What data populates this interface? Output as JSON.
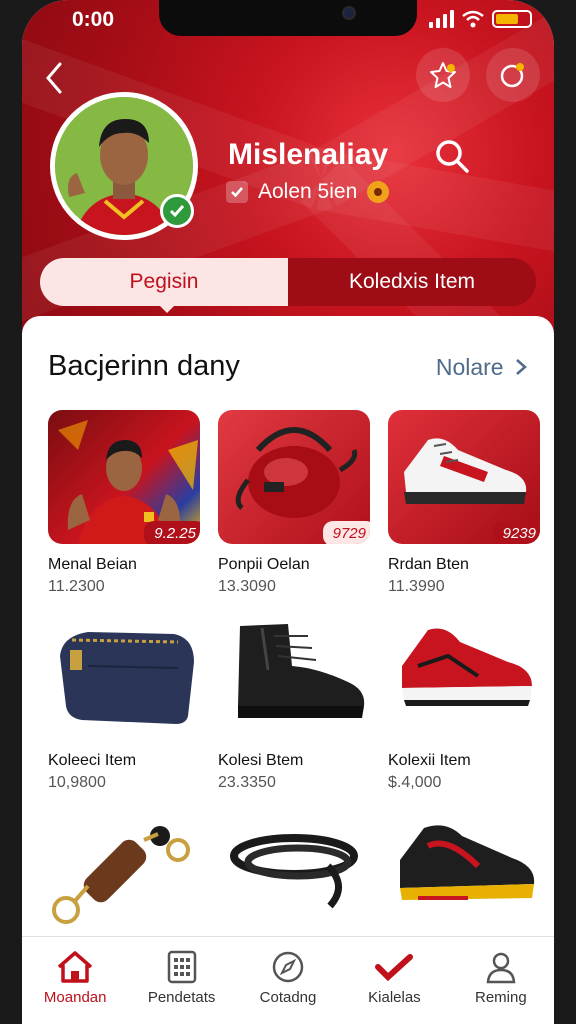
{
  "status_bar": {
    "time": "0:00"
  },
  "profile": {
    "name": "Mislenaliay",
    "subtitle": "Aolen 5ien"
  },
  "tabs": [
    {
      "label": "Pegisin",
      "active": true
    },
    {
      "label": "Koledxis Item",
      "active": false
    }
  ],
  "section": {
    "title": "Bacjerinn dany",
    "more_label": "Nolare"
  },
  "items": [
    {
      "name": "Menal Beian",
      "price": "11.2300",
      "badge": "9.2.25",
      "image": "player-poster"
    },
    {
      "name": "Ponpii Oelan",
      "price": "13.3090",
      "badge": "9729",
      "image": "red-helmet-bag"
    },
    {
      "name": "Rrdan Bten",
      "price": "11.3990",
      "badge": "9239",
      "image": "white-red-sneaker"
    },
    {
      "name": "Koleeci Item",
      "price": "10,9800",
      "badge": "",
      "image": "navy-pouch"
    },
    {
      "name": "Kolesi Btem",
      "price": "23.3350",
      "badge": "",
      "image": "black-boot"
    },
    {
      "name": "Kolexii Item",
      "price": "$.4,000",
      "badge": "",
      "image": "red-sneaker"
    },
    {
      "name": "",
      "price": "",
      "badge": "",
      "image": "keychain"
    },
    {
      "name": "",
      "price": "",
      "badge": "",
      "image": "black-laces"
    },
    {
      "name": "",
      "price": "",
      "badge": "",
      "image": "black-yellow-boot"
    }
  ],
  "bottom_nav": [
    {
      "label": "Moandan",
      "icon": "home-icon",
      "active": true
    },
    {
      "label": "Pendetats",
      "icon": "calendar-grid-icon",
      "active": false
    },
    {
      "label": "Cotadng",
      "icon": "compass-icon",
      "active": false
    },
    {
      "label": "Kialelas",
      "icon": "checkmark-icon",
      "active": false
    },
    {
      "label": "Reming",
      "icon": "user-icon",
      "active": false
    }
  ],
  "colors": {
    "brand_red": "#c0101c",
    "dark_red": "#9e0c15",
    "accent_link": "#4e6b8a"
  }
}
